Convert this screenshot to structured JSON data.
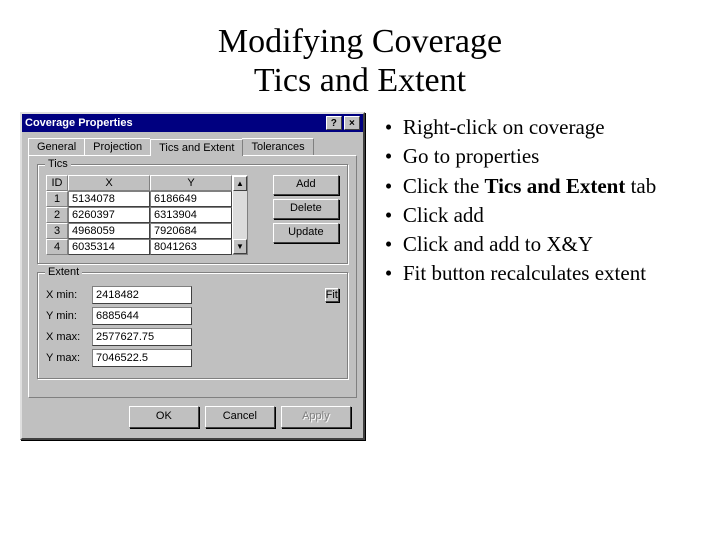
{
  "title_line1": "Modifying Coverage",
  "title_line2": "Tics and Extent",
  "dialog": {
    "title": "Coverage Properties",
    "help_glyph": "?",
    "close_glyph": "×",
    "tabs": {
      "general": "General",
      "projection": "Projection",
      "tics": "Tics and Extent",
      "tolerances": "Tolerances"
    },
    "tics_group": {
      "legend": "Tics",
      "headers": {
        "id": "ID",
        "x": "X",
        "y": "Y"
      },
      "rows": [
        {
          "id": "1",
          "x": "5134078",
          "y": "6186649"
        },
        {
          "id": "2",
          "x": "6260397",
          "y": "6313904"
        },
        {
          "id": "3",
          "x": "4968059",
          "y": "7920684"
        },
        {
          "id": "4",
          "x": "6035314",
          "y": "8041263"
        }
      ],
      "scroll_up": "▲",
      "scroll_down": "▼",
      "buttons": {
        "add": "Add",
        "delete": "Delete",
        "update": "Update"
      }
    },
    "extent_group": {
      "legend": "Extent",
      "xmin_label": "X min:",
      "xmin_value": "2418482",
      "ymin_label": "Y min:",
      "ymin_value": "6885644",
      "xmax_label": "X max:",
      "xmax_value": "2577627.75",
      "ymax_label": "Y max:",
      "ymax_value": "7046522.5",
      "fit": "Fit"
    },
    "buttons": {
      "ok": "OK",
      "cancel": "Cancel",
      "apply": "Apply"
    }
  },
  "bullets": {
    "i0": "Right-click on coverage",
    "i1": "Go to properties",
    "i2a": "Click the ",
    "i2b": "Tics and Extent",
    "i2c": " tab",
    "i3": "Click add",
    "i4": "Click and add to X&Y",
    "i5": "Fit button recalculates extent"
  }
}
